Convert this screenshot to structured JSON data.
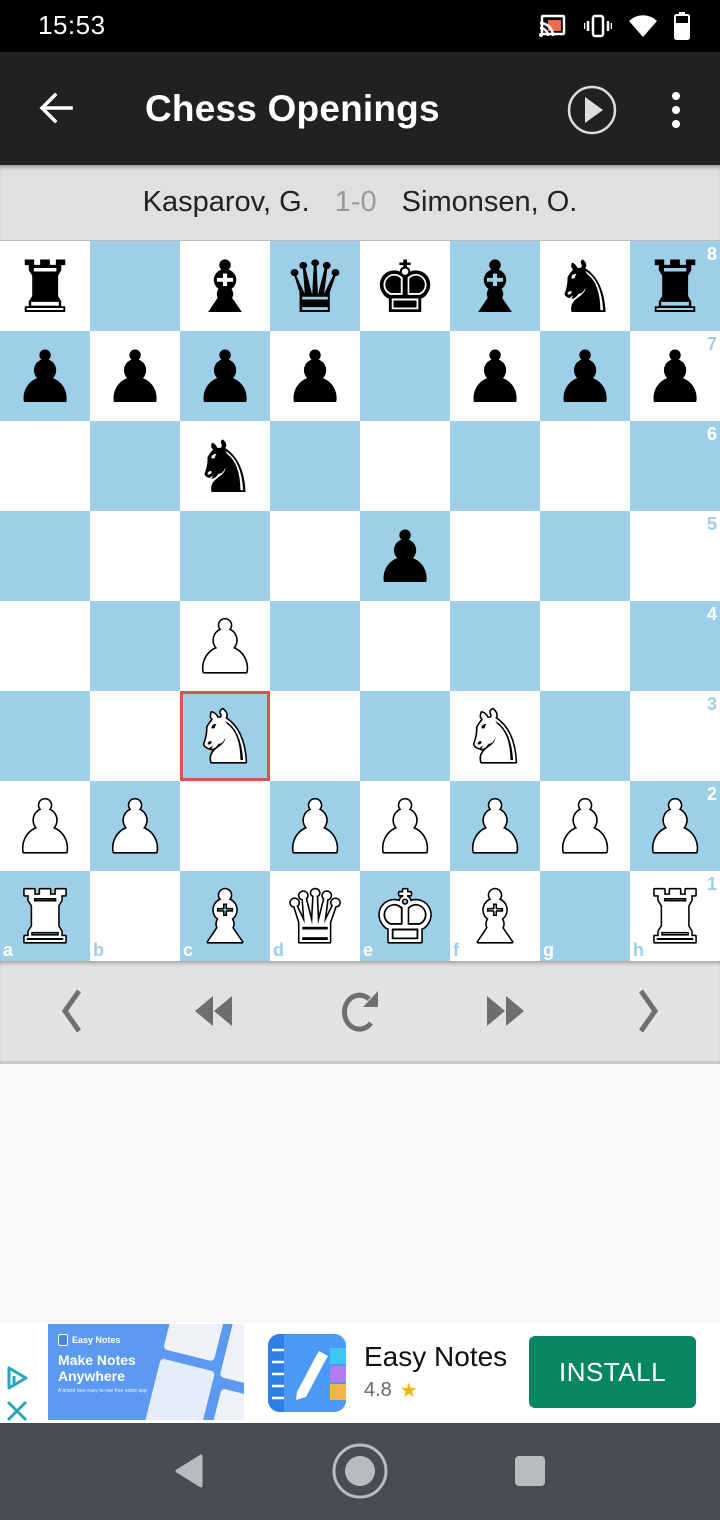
{
  "status_bar": {
    "time": "15:53",
    "icons": [
      "cast-icon",
      "vibrate-icon",
      "wifi-icon",
      "battery-icon"
    ]
  },
  "app_bar": {
    "title": "Chess Openings",
    "back_icon": "arrow-back-icon",
    "play_icon": "play-circle-icon",
    "more_icon": "more-vert-icon"
  },
  "game": {
    "white_player": "Kasparov, G.",
    "result": "1-0",
    "black_player": "Simonsen, O."
  },
  "board": {
    "orientation": "white-bottom",
    "files": [
      "a",
      "b",
      "c",
      "d",
      "e",
      "f",
      "g",
      "h"
    ],
    "ranks": [
      "8",
      "7",
      "6",
      "5",
      "4",
      "3",
      "2",
      "1"
    ],
    "position": [
      [
        "r",
        "",
        "b",
        "q",
        "k",
        "b",
        "n",
        "r"
      ],
      [
        "p",
        "p",
        "p",
        "p",
        "",
        "p",
        "p",
        "p"
      ],
      [
        "",
        "",
        "n",
        "",
        "",
        "",
        "",
        ""
      ],
      [
        "",
        "",
        "",
        "",
        "p",
        "",
        "",
        ""
      ],
      [
        "",
        "",
        "P",
        "",
        "",
        "",
        "",
        ""
      ],
      [
        "",
        "",
        "N",
        "",
        "",
        "N",
        "",
        ""
      ],
      [
        "P",
        "P",
        "",
        "P",
        "P",
        "P",
        "P",
        "P"
      ],
      [
        "R",
        "",
        "B",
        "Q",
        "K",
        "B",
        "",
        "R"
      ]
    ],
    "highlighted_square": "c3",
    "colors": {
      "light": "#ffffff",
      "dark": "#9ecfe9",
      "highlight": "#d9534f"
    }
  },
  "controls": [
    {
      "name": "previous-move-button",
      "icon": "chevron-left-icon"
    },
    {
      "name": "first-move-button",
      "icon": "rewind-icon"
    },
    {
      "name": "reset-button",
      "icon": "refresh-icon"
    },
    {
      "name": "last-move-button",
      "icon": "fast-forward-icon"
    },
    {
      "name": "next-move-button",
      "icon": "chevron-right-icon"
    }
  ],
  "ad": {
    "banner_brand": "Easy Notes",
    "banner_headline_1": "Make Notes",
    "banner_headline_2": "Anywhere",
    "banner_sub": "A brand new easy-to-use free notes app",
    "app_name": "Easy Notes",
    "rating": "4.8",
    "rating_icon": "★",
    "install_label": "INSTALL",
    "install_color": "#07875f"
  },
  "nav_bar": {
    "buttons": [
      "back-icon",
      "home-icon",
      "recents-icon"
    ]
  }
}
